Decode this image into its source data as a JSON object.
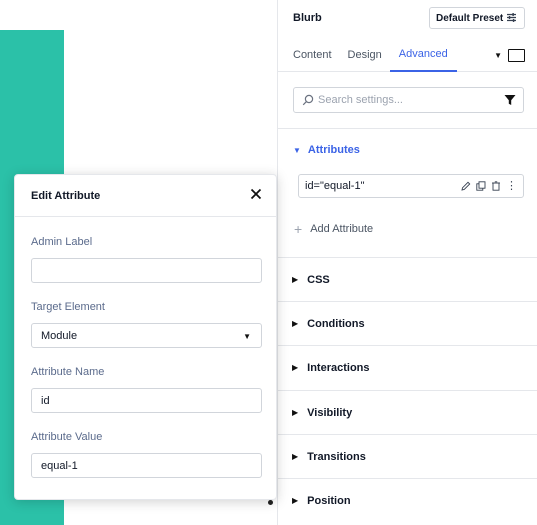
{
  "header": {
    "module_title": "Blurb",
    "preset_label": "Default Preset",
    "preset_icon": "sliders-icon"
  },
  "tabs": [
    {
      "label": "Content",
      "active": false
    },
    {
      "label": "Design",
      "active": false
    },
    {
      "label": "Advanced",
      "active": true
    }
  ],
  "search": {
    "placeholder": "Search settings...",
    "value": ""
  },
  "attributes_section": {
    "label": "Attributes",
    "expanded": true,
    "items": [
      {
        "text": "id=\"equal-1\""
      }
    ],
    "add_label": "Add Attribute"
  },
  "groups": [
    {
      "label": "CSS"
    },
    {
      "label": "Conditions"
    },
    {
      "label": "Interactions"
    },
    {
      "label": "Visibility"
    },
    {
      "label": "Transitions"
    },
    {
      "label": "Position"
    }
  ],
  "modal": {
    "title": "Edit Attribute",
    "fields": {
      "admin_label": {
        "label": "Admin Label",
        "value": ""
      },
      "target_element": {
        "label": "Target Element",
        "value": "Module"
      },
      "attribute_name": {
        "label": "Attribute Name",
        "value": "id"
      },
      "attribute_value": {
        "label": "Attribute Value",
        "value": "equal-1"
      }
    }
  },
  "colors": {
    "accent": "#3b63e6",
    "canvas_block": "#2bc1a8",
    "label_muted": "#5b6b8c"
  }
}
